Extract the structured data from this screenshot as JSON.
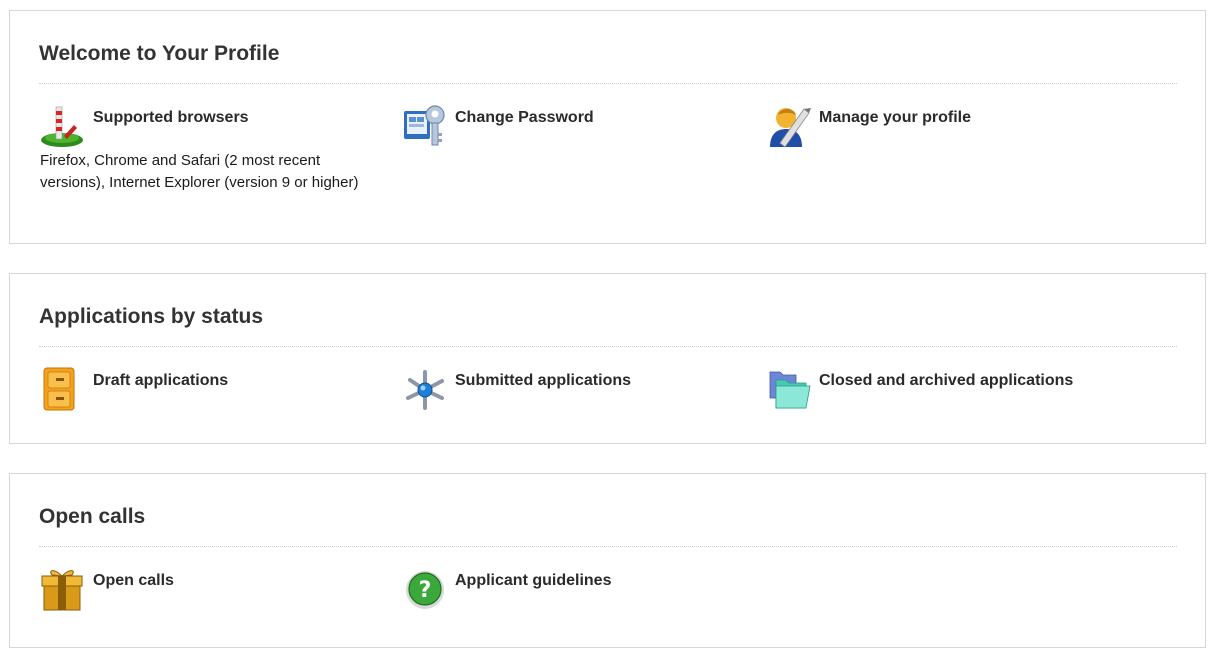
{
  "profile": {
    "title": "Welcome to Your Profile",
    "supported_browsers_label": "Supported browsers",
    "supported_browsers_desc": "Firefox, Chrome and Safari (2 most recent versions), Internet Explorer (version 9 or higher)",
    "change_password_label": "Change Password",
    "manage_profile_label": "Manage your profile"
  },
  "applications": {
    "title": "Applications by status",
    "draft_label": "Draft applications",
    "submitted_label": "Submitted applications",
    "closed_label": "Closed and archived applications"
  },
  "calls": {
    "title": "Open calls",
    "open_calls_label": "Open calls",
    "guidelines_label": "Applicant guidelines"
  },
  "icons": {
    "browsers": "signpost-icon",
    "password": "key-icon",
    "profile": "user-pen-icon",
    "draft": "file-cabinet-icon",
    "submitted": "network-hub-icon",
    "closed": "folders-icon",
    "open_calls": "gift-box-icon",
    "guidelines": "question-mark-icon"
  }
}
